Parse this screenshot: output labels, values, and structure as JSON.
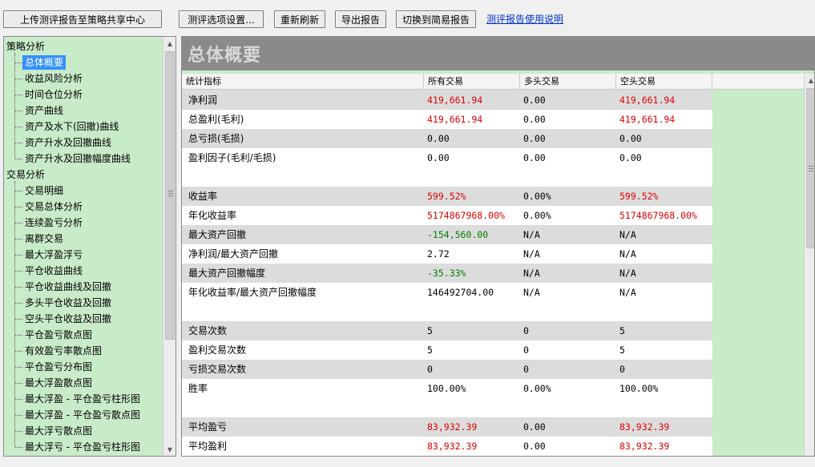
{
  "toolbar": {
    "upload": "上传测评报告至策略共享中心",
    "settings": "测评选项设置...",
    "refresh": "重新刷新",
    "export": "导出报告",
    "switch": "切换到简易报告",
    "help_link": "测评报告使用说明"
  },
  "tree": {
    "groups": [
      {
        "label": "策略分析",
        "children": [
          "总体概要",
          "收益风险分析",
          "时间仓位分析",
          "资产曲线",
          "资产及水下(回撤)曲线",
          "资产升水及回撤曲线",
          "资产升水及回撤幅度曲线"
        ]
      },
      {
        "label": "交易分析",
        "children": [
          "交易明细",
          "交易总体分析",
          "连续盈亏分析",
          "离群交易",
          "最大浮盈浮亏",
          "平仓收益曲线",
          "平仓收益曲线及回撤",
          "多头平仓收益及回撤",
          "空头平仓收益及回撤",
          "平仓盈亏散点图",
          "有效盈亏率散点图",
          "平仓盈亏分布图",
          "最大浮盈散点图",
          "最大浮盈 - 平仓盈亏柱形图",
          "最大浮盈 - 平仓盈亏散点图",
          "最大浮亏散点图",
          "最大浮亏 - 平仓盈亏柱形图"
        ]
      }
    ],
    "selected": "总体概要"
  },
  "panel": {
    "title": "总体概要",
    "headers": [
      "统计指标",
      "所有交易",
      "多头交易",
      "空头交易"
    ],
    "rows": [
      {
        "label": "净利润",
        "all": "419,661.94",
        "long": "0.00",
        "short": "419,661.94",
        "color": "red"
      },
      {
        "label": "总盈利(毛利)",
        "all": "419,661.94",
        "long": "0.00",
        "short": "419,661.94",
        "color": "red"
      },
      {
        "label": "总亏损(毛损)",
        "all": "0.00",
        "long": "0.00",
        "short": "0.00",
        "color": "black"
      },
      {
        "label": "盈利因子(毛利/毛损)",
        "all": "0.00",
        "long": "0.00",
        "short": "0.00",
        "color": "black",
        "tall": true
      },
      {
        "label": "收益率",
        "all": "599.52%",
        "long": "0.00%",
        "short": "599.52%",
        "color": "red"
      },
      {
        "label": "年化收益率",
        "all": "5174867968.00%",
        "long": "0.00%",
        "short": "5174867968.00%",
        "color": "red"
      },
      {
        "label": "最大资产回撤",
        "all": "-154,560.00",
        "long": "N/A",
        "short": "N/A",
        "color": "green"
      },
      {
        "label": "净利润/最大资产回撤",
        "all": "2.72",
        "long": "N/A",
        "short": "N/A",
        "color": "black"
      },
      {
        "label": "最大资产回撤幅度",
        "all": "-35.33%",
        "long": "N/A",
        "short": "N/A",
        "color": "green"
      },
      {
        "label": "年化收益率/最大资产回撤幅度",
        "all": "146492704.00",
        "long": "N/A",
        "short": "N/A",
        "color": "black",
        "tall": true
      },
      {
        "label": "交易次数",
        "all": "5",
        "long": "0",
        "short": "5",
        "color": "black"
      },
      {
        "label": "盈利交易次数",
        "all": "5",
        "long": "0",
        "short": "5",
        "color": "black"
      },
      {
        "label": "亏损交易次数",
        "all": "0",
        "long": "0",
        "short": "0",
        "color": "black"
      },
      {
        "label": "胜率",
        "all": "100.00%",
        "long": "0.00%",
        "short": "100.00%",
        "color": "black",
        "tall": true
      },
      {
        "label": "平均盈亏",
        "all": "83,932.39",
        "long": "0.00",
        "short": "83,932.39",
        "color": "red"
      },
      {
        "label": "平均盈利",
        "all": "83,932.39",
        "long": "0.00",
        "short": "83,932.39",
        "color": "red"
      }
    ]
  },
  "colors": {
    "panel_bg": "#c8ebc8",
    "banner_bg": "#8a8a8a",
    "selected": "#3390ff",
    "red": "#e00000",
    "green": "#008000"
  }
}
